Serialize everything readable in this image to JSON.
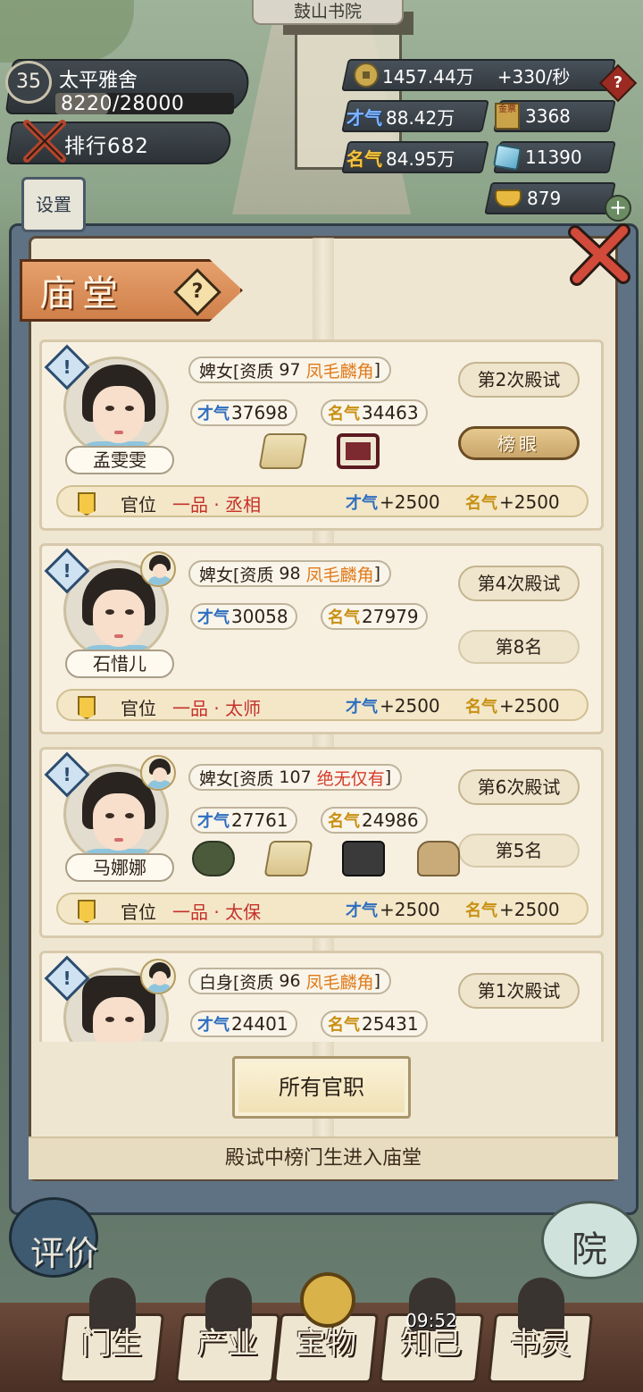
{
  "place_title": "鼓山书院",
  "player": {
    "level": "35",
    "name": "太平雅舍",
    "exp": "8220/28000",
    "exp_fraction": 0.2936,
    "rank": "排行682"
  },
  "settings_label": "设置",
  "resources": {
    "money": "1457.44万",
    "money_rate": "+330/秒",
    "talent": "88.42万",
    "fame": "84.95万",
    "book_count": "3368",
    "gem_count": "11390",
    "ingot_count": "879",
    "talent_icon_text": "才气",
    "fame_icon_text": "名气",
    "book_icon_text": "金票",
    "alert_icon": "?",
    "plus_icon": "+"
  },
  "modal": {
    "title": "庙堂",
    "help_icon": "?",
    "all_offices_button": "所有官职",
    "footer_note": "殿试中榜门生进入庙堂"
  },
  "students": [
    {
      "name": "孟雯雯",
      "role_prefix": "婢女[资质",
      "aptitude": "97",
      "quality": "凤毛麟角",
      "quality_level": "hi",
      "role_suffix": "]",
      "talent": "37698",
      "fame": "34463",
      "exam": "第2次殿试",
      "result": "榜眼",
      "result_special": true,
      "has_mini_avatar": false,
      "avatar_gender": "female",
      "items": [
        "scroll-icon",
        "frame-icon"
      ],
      "office_label": "官位",
      "office": "一品 · 丞相",
      "talent_bonus": "+2500",
      "fame_bonus": "+2500"
    },
    {
      "name": "石惜儿",
      "role_prefix": "婢女[资质",
      "aptitude": "98",
      "quality": "凤毛麟角",
      "quality_level": "hi",
      "role_suffix": "]",
      "talent": "30058",
      "fame": "27979",
      "exam": "第4次殿试",
      "result": "第8名",
      "result_special": false,
      "has_mini_avatar": true,
      "avatar_gender": "female",
      "items": [],
      "office_label": "官位",
      "office": "一品 · 太师",
      "talent_bonus": "+2500",
      "fame_bonus": "+2500"
    },
    {
      "name": "马娜娜",
      "role_prefix": "婢女[资质",
      "aptitude": "107",
      "quality": "绝无仅有",
      "quality_level": "top",
      "role_suffix": "]",
      "talent": "27761",
      "fame": "24986",
      "exam": "第6次殿试",
      "result": "第5名",
      "result_special": false,
      "has_mini_avatar": true,
      "avatar_gender": "female",
      "items": [
        "ink-stone-icon",
        "scroll-icon",
        "book-icon",
        "pouch-icon"
      ],
      "office_label": "官位",
      "office": "一品 · 太保",
      "talent_bonus": "+2500",
      "fame_bonus": "+2500"
    },
    {
      "name": "",
      "role_prefix": "白身[资质",
      "aptitude": "96",
      "quality": "凤毛麟角",
      "quality_level": "hi",
      "role_suffix": "]",
      "talent": "24401",
      "fame": "25431",
      "exam": "第1次殿试",
      "result": "",
      "result_special": false,
      "has_mini_avatar": true,
      "avatar_gender": "male",
      "items": [],
      "office_label": "",
      "office": "",
      "talent_bonus": "",
      "fame_bonus": ""
    }
  ],
  "side_buttons": {
    "left": "评价",
    "right": "院"
  },
  "nav": [
    {
      "label": "门生",
      "icon": "student-figure-icon"
    },
    {
      "label": "产业",
      "icon": "map-scroll-icon"
    },
    {
      "label": "宝物",
      "icon": "compass-icon"
    },
    {
      "label": "知己",
      "icon": "confidant-figure-icon",
      "timer": "09:52"
    },
    {
      "label": "书灵",
      "icon": "book-spirit-icon"
    }
  ]
}
